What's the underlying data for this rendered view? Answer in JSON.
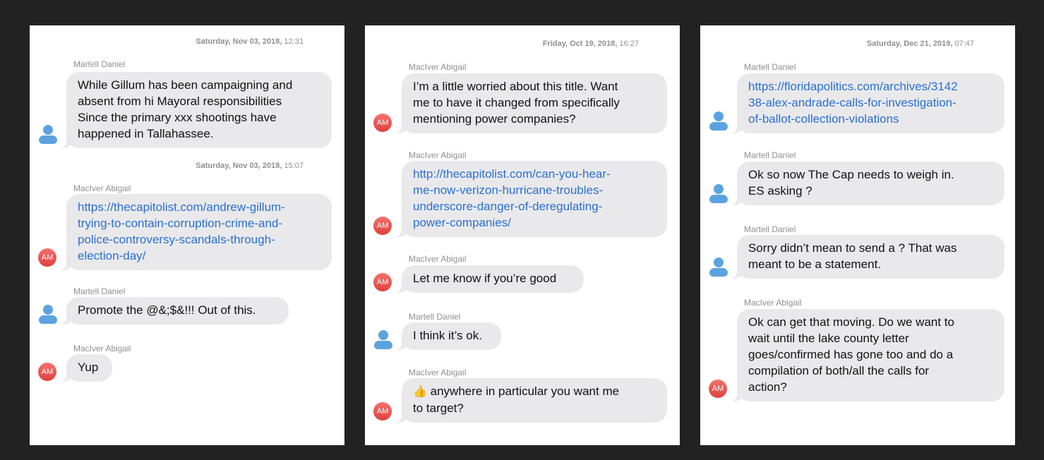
{
  "panels": [
    {
      "timestamps": [
        {
          "date": "Saturday, Nov 03, 2018,",
          "time": "12:31"
        },
        {
          "date": "Saturday, Nov 03, 2018,",
          "time": "15:07"
        }
      ],
      "messages": [
        {
          "sender": "Martell Daniel",
          "avatar": "person-icon",
          "text": "While Gillum has been campaigning and\nabsent from hi Mayoral responsibilities\nSince the primary xxx shootings have\nhappened in Tallahassee."
        },
        {
          "sender": "MacIver Abigail",
          "avatar": "AM",
          "link": "https://thecapitolist.com/andrew-gillum-\ntrying-to-contain-corruption-crime-and-\npolice-controversy-scandals-through-\nelection-day/"
        },
        {
          "sender": "Martell Daniel",
          "avatar": "person-icon",
          "text": "Promote the @&;$&!!! Out of this."
        },
        {
          "sender": "MacIver Abigail",
          "avatar": "AM",
          "text": "Yup"
        }
      ]
    },
    {
      "timestamps": [
        {
          "date": "Friday, Oct 19, 2018,",
          "time": "16:27"
        }
      ],
      "messages": [
        {
          "sender": "MacIver Abigail",
          "avatar": "AM",
          "text": "I’m a little worried about this title. Want\nme to have it changed from specifically\nmentioning power companies?"
        },
        {
          "sender": "MacIver Abigail",
          "avatar": "AM",
          "link": "http://thecapitolist.com/can-you-hear-\nme-now-verizon-hurricane-troubles-\nunderscore-danger-of-deregulating-\npower-companies/"
        },
        {
          "sender": "MacIver Abigail",
          "avatar": "AM",
          "text": "Let me know if you’re good"
        },
        {
          "sender": "Martell Daniel",
          "avatar": "person-icon",
          "text": "I think it’s ok."
        },
        {
          "sender": "MacIver Abigail",
          "avatar": "AM",
          "emoji": "👍",
          "text": " anywhere in particular you want me\nto target?"
        }
      ]
    },
    {
      "timestamps": [
        {
          "date": "Saturday, Dec 21, 2019,",
          "time": "07:47"
        }
      ],
      "messages": [
        {
          "sender": "Martell Daniel",
          "avatar": "person-icon",
          "link": "https://floridapolitics.com/archives/3142\n38-alex-andrade-calls-for-investigation-\nof-ballot-collection-violations"
        },
        {
          "sender": "Martell Daniel",
          "avatar": "person-icon",
          "text": "Ok so now The Cap needs to weigh in.\nES asking ?"
        },
        {
          "sender": "Martell Daniel",
          "avatar": "person-icon",
          "text": "Sorry didn’t mean to send a ? That was\nmeant to be a statement."
        },
        {
          "sender": "MacIver Abigail",
          "avatar": "AM",
          "text": "Ok can get that moving. Do we want to\nwait until the lake county letter\ngoes/confirmed has gone too and do a\ncompilation of both/all the calls for\naction?"
        }
      ]
    }
  ]
}
